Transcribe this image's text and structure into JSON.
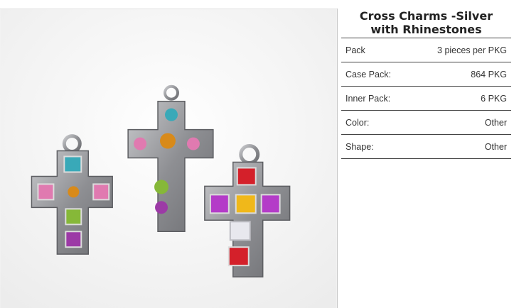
{
  "product": {
    "title_line1": "Cross Charms -Silver",
    "title_line2": "with Rhinestones",
    "specs": [
      {
        "label": "Pack",
        "value": "3 pieces per PKG"
      },
      {
        "label": "Case Pack:",
        "value": "864 PKG"
      },
      {
        "label": "Inner Pack:",
        "value": "6 PKG"
      },
      {
        "label": "Color:",
        "value": "Other"
      },
      {
        "label": "Shape:",
        "value": "Other"
      }
    ]
  },
  "image": {
    "stone_colors": {
      "teal": "#39a9b8",
      "pink": "#e07ab0",
      "amber": "#d88a1a",
      "green": "#86b838",
      "purple": "#9c3aa6",
      "red": "#d4202a",
      "yellow": "#f0b81a",
      "violet": "#b43cc8",
      "clear": "#e8e8ee",
      "silver": "#8e8f93"
    }
  }
}
